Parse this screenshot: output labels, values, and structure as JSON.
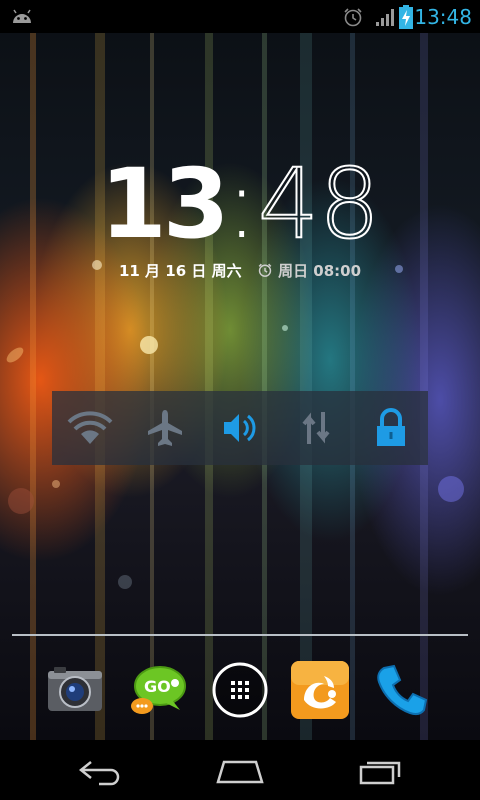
{
  "status_bar": {
    "time": "13:48",
    "notification_icon": "android-robot-icon",
    "icons": [
      "alarm-icon",
      "signal-icon",
      "battery-charging-icon"
    ],
    "accent_color": "#33b5e5"
  },
  "lockscreen_clock": {
    "hours": "13",
    "separator": ":",
    "minutes": "48",
    "date": "11 月 16 日 周六",
    "alarm_text": "周日 08:00"
  },
  "power_widget": {
    "buttons": [
      {
        "icon": "wifi-icon",
        "state": "off"
      },
      {
        "icon": "airplane-icon",
        "state": "off"
      },
      {
        "icon": "sound-icon",
        "state": "on"
      },
      {
        "icon": "data-sync-icon",
        "state": "off"
      },
      {
        "icon": "lock-icon",
        "state": "on"
      }
    ]
  },
  "dock": {
    "apps": [
      "camera-app-icon",
      "go-sms-app-icon",
      "all-apps-icon",
      "uc-browser-app-icon",
      "phone-app-icon"
    ]
  },
  "navigation_bar": {
    "buttons": [
      "back-icon",
      "home-icon",
      "recent-apps-icon"
    ]
  }
}
